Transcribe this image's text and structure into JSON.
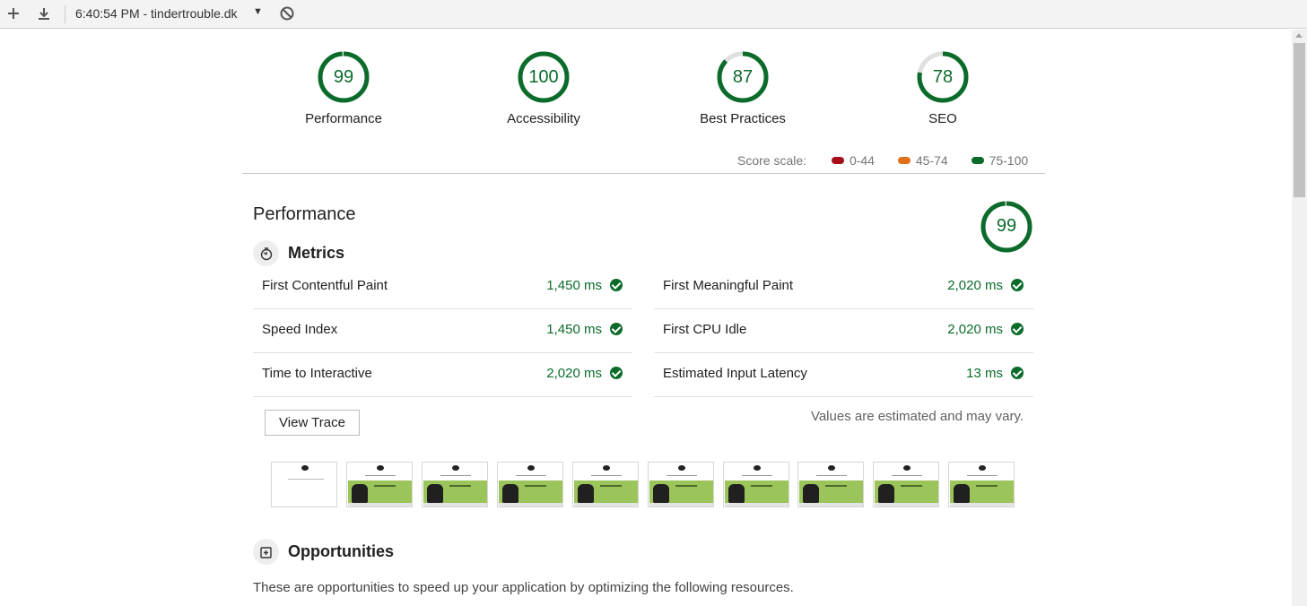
{
  "toolbar": {
    "title": "6:40:54 PM - tindertrouble.dk",
    "new_icon": "plus-icon",
    "download_icon": "download-icon",
    "dropdown_icon": "caret-down-icon",
    "block_icon": "block-icon"
  },
  "gauges": [
    {
      "score": "99",
      "label": "Performance",
      "fraction": 0.99
    },
    {
      "score": "100",
      "label": "Accessibility",
      "fraction": 1.0
    },
    {
      "score": "87",
      "label": "Best Practices",
      "fraction": 0.87
    },
    {
      "score": "78",
      "label": "SEO",
      "fraction": 0.78
    }
  ],
  "scale": {
    "label": "Score scale:",
    "ranges": [
      {
        "text": "0-44",
        "color": "#a50e1a"
      },
      {
        "text": "45-74",
        "color": "#e1711a"
      },
      {
        "text": "75-100",
        "color": "#0b6b2a"
      }
    ]
  },
  "colors": {
    "pass": "#0b6b2a",
    "gauge_track": "#e0e0e0"
  },
  "performance": {
    "title": "Performance",
    "score": "99",
    "score_fraction": 0.99,
    "metrics_title": "Metrics",
    "metrics_icon": "stopwatch-icon",
    "metrics": [
      {
        "name": "First Contentful Paint",
        "value": "1,450 ms"
      },
      {
        "name": "First Meaningful Paint",
        "value": "2,020 ms"
      },
      {
        "name": "Speed Index",
        "value": "1,450 ms"
      },
      {
        "name": "First CPU Idle",
        "value": "2,020 ms"
      },
      {
        "name": "Time to Interactive",
        "value": "2,020 ms"
      },
      {
        "name": "Estimated Input Latency",
        "value": "13 ms"
      }
    ],
    "view_trace": "View Trace",
    "estimated_note": "Values are estimated and may vary.",
    "opportunities_title": "Opportunities",
    "opportunities_icon": "opportunity-icon",
    "opportunities_desc": "These are opportunities to speed up your application by optimizing the following resources."
  }
}
